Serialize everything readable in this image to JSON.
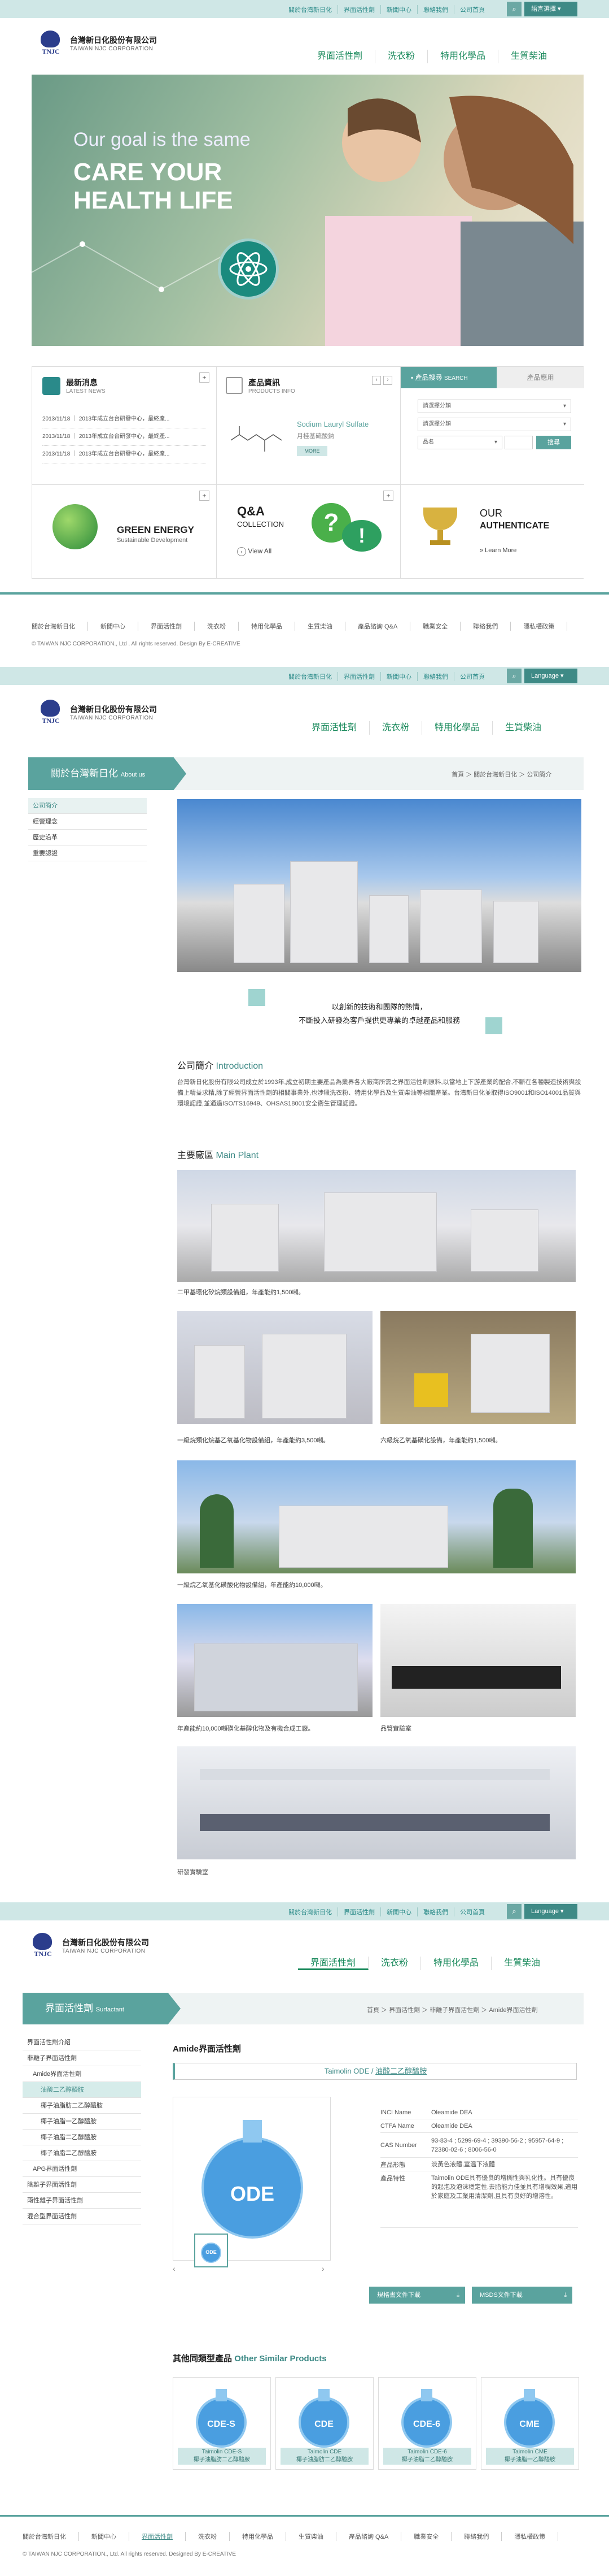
{
  "top_links": [
    "關於台灣新日化",
    "界面活性劑",
    "新聞中心",
    "聯絡我們",
    "公司首頁"
  ],
  "top_links2": [
    "關於台灣新日化",
    "界面活性劑",
    "新聞中心",
    "聯絡我們",
    "公司首頁"
  ],
  "lang_label": "語言選擇",
  "lang_label2": "Language",
  "logo": {
    "mark": "TNJC",
    "name_cn": "台灣新日化股份有限公司",
    "name_en": "TAIWAN NJC CORPORATION"
  },
  "nav": [
    "界面活性劑",
    "洗衣粉",
    "特用化學品",
    "生質柴油"
  ],
  "hero": {
    "line1": "Our goal is the same",
    "line2": "CARE YOUR HEALTH LIFE"
  },
  "news": {
    "title": "最新消息",
    "sub": "LATEST NEWS",
    "items": [
      "2013/11/18 ｜ 2013年成立台台研發中心，最終產...",
      "2013/11/18 ｜ 2013年成立台台研發中心，最終產...",
      "2013/11/18 ｜ 2013年成立台台研發中心，最終產..."
    ]
  },
  "products": {
    "title": "產品資訊",
    "sub": "PRODUCTS INFO",
    "name": "Sodium Lauryl Sulfate",
    "cn": "月桂基硫酸鈉",
    "more": "MORE"
  },
  "search": {
    "tab1": "產品搜尋",
    "tab1_en": "SEARCH",
    "tab2": "產品應用",
    "sel1": "請選擇分類",
    "sel2": "請選擇分類",
    "sel3": "品名",
    "btn": "搜尋"
  },
  "green": {
    "title": "GREEN ENERGY",
    "sub": "Sustainable Development"
  },
  "qa": {
    "title": "Q&A",
    "sub": "COLLECTION",
    "link": "View All"
  },
  "auth": {
    "l1": "OUR",
    "l2": "AUTHENTICATE",
    "link": "» Learn More"
  },
  "footer_links": [
    "關於台灣新日化",
    "新聞中心",
    "界面活性劑",
    "洗衣粉",
    "特用化學品",
    "生質柴油",
    "產品諮詢 Q&A",
    "職業安全",
    "聯絡我們",
    "隱私權政策"
  ],
  "footer_copy": "© TAIWAN NJC CORPORATION., Ltd . All rights reserved.  Design By E-CREATIVE",
  "about": {
    "side_title": "關於台灣新日化",
    "side_en": "About us",
    "side_items": [
      "公司簡介",
      "經營理念",
      "歷史沿革",
      "重要認證"
    ],
    "crumb": "首頁 ＞ 關於台灣新日化 ＞ 公司簡介",
    "banner_l1": "以創新的技術和團隊的熱情，",
    "banner_l2": "不斷投入研發為客戶提供更專業的卓越產品和服務",
    "intro_cn": "公司簡介",
    "intro_en": "Introduction",
    "intro_text": "台灣新日化股份有限公司成立於1993年,成立初期主要產品為業界各大廠商所需之界面活性劑原料,以當地上下游產業的配合,不斷在各種製造技術與設備上精益求精,除了經營界面活性劑的相關事業外,也涉獵洗衣粉、特用化學品及生質柴油等相關產業。台灣新日化並取得ISO9001和ISO14001品質與環境認證,並通過ISO/TS16949、OHSAS18001安全衛生管理認證。",
    "plant_cn": "主要廠區",
    "plant_en": "Main Plant",
    "captions": [
      "二甲基環化矽烷類設備組，年產能約1,500噸。",
      "一級烷類化烷基乙氧基化物設備組，年產能約3,500噸。",
      "六級烷乙氧基磺化設備，年產能約1,500噸。",
      "一級烷乙氧基化磺酸化物設備組，年產能約10,000噸。",
      "年產能約10,000噸磺化基醇化物及有機合成工廠。",
      "品管實驗室",
      "研發實驗室"
    ]
  },
  "product": {
    "side_title": "界面活性劑",
    "side_en": "Surfactant",
    "side_items": [
      "界面活性劑介紹",
      "非離子界面活性劑",
      "Amide界面活性劑",
      "油酸二乙醇醯胺",
      "椰子油脂肪二乙醇醯胺",
      "椰子油脂一乙醇醯胺",
      "椰子油脂二乙醇醯胺",
      "椰子油脂二乙醇醯胺",
      "APG界面活性劑",
      "陰離子界面活性劑",
      "兩性離子界面活性劑",
      "混合型界面活性劑"
    ],
    "crumb": "首頁 ＞ 界面活性劑 ＞ 非離子界面活性劑 ＞ Amide界面活性劑",
    "heading": "Amide界面活性劑",
    "name_en": "Taimolin ODE",
    "name_cn": "油酸二乙醇醯胺",
    "flask_label": "ODE",
    "specs": [
      {
        "k": "INCI Name",
        "v": "Oleamide DEA"
      },
      {
        "k": "CTFA Name",
        "v": "Oleamide DEA"
      },
      {
        "k": "CAS Number",
        "v": "93-83-4 ; 5299-69-4 ; 39390-56-2 ; 95957-64-9 ; 72380-02-6 ; 8006-56-0"
      },
      {
        "k": "產品形態",
        "v": "淡黃色液體,室溫下液體"
      },
      {
        "k": "產品特性",
        "v": "Taimolin ODE具有優良的增稠性與乳化性。具有優良的起泡及泡沫穩定性,去脂能力佳並具有增稠效果,適用於家庭及工業用清潔劑,且具有良好的增溶性。"
      }
    ],
    "dl1": "規格書文件下載",
    "dl2": "MSDS文件下載",
    "other_cn": "其他同類型產品",
    "other_en": "Other Similar Products",
    "similar": [
      {
        "flask": "CDE-S",
        "name": "Taimolin CDE-S",
        "cn": "椰子油脂肪二乙醇醯胺"
      },
      {
        "flask": "CDE",
        "name": "Taimolin CDE",
        "cn": "椰子油脂肪二乙醇醯胺"
      },
      {
        "flask": "CDE-6",
        "name": "Taimolin CDE-6",
        "cn": "椰子油脂二乙醇醯胺"
      },
      {
        "flask": "CME",
        "name": "Taimolin CME",
        "cn": "椰子油脂一乙醇醯胺"
      }
    ]
  },
  "footer_links3": [
    "關於台灣新日化",
    "新聞中心",
    "界面活性劑",
    "洗衣粉",
    "特用化學品",
    "生質柴油",
    "產品諮詢 Q&A",
    "職業安全",
    "聯絡我們",
    "隱私權政策"
  ],
  "footer_copy3": "© TAIWAN NJC CORPORATION., Ltd. All rights reserved. Designed By E-CREATIVE"
}
